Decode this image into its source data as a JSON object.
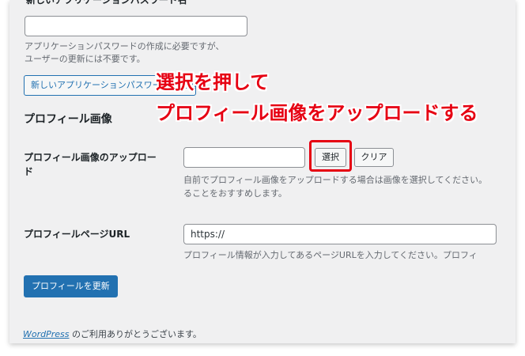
{
  "app_password": {
    "field_label_cut": "新しいアプリケーションパスワード名",
    "name_value": "",
    "description": [
      "アプリケーションパスワードの作成に必要ですが、",
      "ユーザーの更新には不要です。"
    ],
    "add_button_label": "新しいアプリケーションパスワードを追加"
  },
  "profile_picture": {
    "section_title": "プロフィール画像",
    "upload_label_line1": "プロフィール画像のアップロー",
    "upload_label_line2": "ド",
    "upload_value": "",
    "select_button": "選択",
    "clear_button": "クリア",
    "description": [
      "自前でプロフィール画像をアップロードする場合は画像を選択してください。",
      "ることをおすすめします。"
    ]
  },
  "profile_page": {
    "label": "プロフィールページURL",
    "url_value": "https://",
    "description": "プロフィール情報が入力してあるページURLを入力してください。プロフィ"
  },
  "submit_button": "プロフィールを更新",
  "footer": {
    "link_text": "WordPress",
    "suffix": " のご利用ありがとうございます。"
  },
  "annotation": {
    "line1": "選択を押して",
    "line2": "プロフィール画像をアップロードする",
    "color": "#e60012"
  },
  "colors": {
    "accent": "#2271b1",
    "background": "#f0f0f1",
    "highlight": "#e60012"
  }
}
